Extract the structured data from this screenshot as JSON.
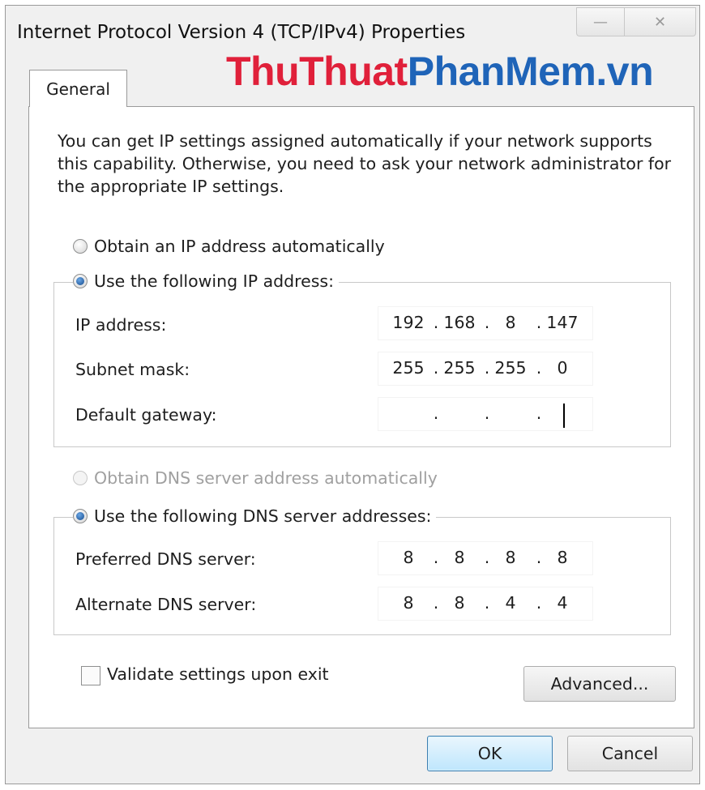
{
  "window": {
    "title": "Internet Protocol Version 4 (TCP/IPv4) Properties",
    "minimize_icon": "minimize-icon",
    "close_icon": "close-icon"
  },
  "watermark": {
    "part1": "ThuThuat",
    "part2": "PhanMem.vn",
    "colors": {
      "red": "#e0203a",
      "blue": "#1f64b8"
    }
  },
  "tabs": [
    {
      "label": "General",
      "active": true
    }
  ],
  "intro": "You can get IP settings assigned automatically if your network supports this capability. Otherwise, you need to ask your network administrator for the appropriate IP settings.",
  "ip": {
    "auto_label": "Obtain an IP address automatically",
    "auto_selected": false,
    "manual_label": "Use the following IP address:",
    "manual_selected": true,
    "fields": [
      {
        "label": "IP address:",
        "octets": [
          "192",
          "168",
          "8",
          "147"
        ]
      },
      {
        "label": "Subnet mask:",
        "octets": [
          "255",
          "255",
          "255",
          "0"
        ]
      },
      {
        "label": "Default gateway:",
        "octets": [
          "",
          "",
          "",
          ""
        ]
      }
    ]
  },
  "dns": {
    "auto_label": "Obtain DNS server address automatically",
    "auto_enabled": false,
    "manual_label": "Use the following DNS server addresses:",
    "manual_selected": true,
    "fields": [
      {
        "label": "Preferred DNS server:",
        "octets": [
          "8",
          "8",
          "8",
          "8"
        ]
      },
      {
        "label": "Alternate DNS server:",
        "octets": [
          "8",
          "8",
          "4",
          "4"
        ]
      }
    ]
  },
  "validate": {
    "label": "Validate settings upon exit",
    "checked": false
  },
  "buttons": {
    "advanced": "Advanced...",
    "ok": "OK",
    "cancel": "Cancel"
  },
  "colors": {
    "dialog_bg": "#f0f0f0",
    "ok_border": "#3c7fb1"
  }
}
